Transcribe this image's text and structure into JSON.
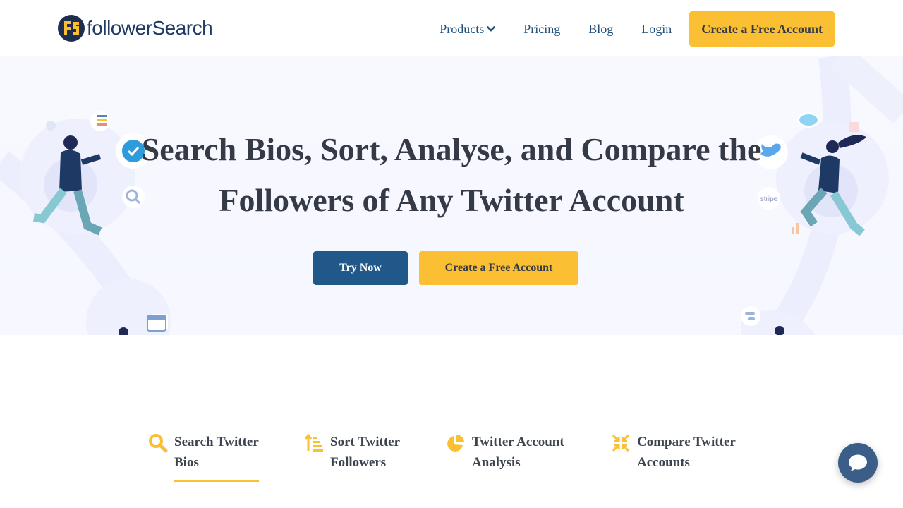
{
  "header": {
    "logo_text": "followerSearch",
    "nav": {
      "products": "Products",
      "pricing": "Pricing",
      "blog": "Blog",
      "login": "Login",
      "cta": "Create a Free Account"
    }
  },
  "hero": {
    "title_line1": "Search Bios, Sort, Analyse, and Compare the",
    "title_line2": "Followers of Any Twitter Account",
    "try_now": "Try Now",
    "create_account": "Create a Free Account",
    "stripe_label": "stripe"
  },
  "features": [
    {
      "label_line1": "Search Twitter",
      "label_line2": "Bios",
      "icon": "search-icon",
      "active": true
    },
    {
      "label_line1": "Sort Twitter",
      "label_line2": "Followers",
      "icon": "sort-icon",
      "active": false
    },
    {
      "label_line1": "Twitter Account",
      "label_line2": "Analysis",
      "icon": "pie-chart-icon",
      "active": false
    },
    {
      "label_line1": "Compare Twitter",
      "label_line2": "Accounts",
      "icon": "compress-icon",
      "active": false
    }
  ],
  "colors": {
    "accent_yellow": "#fbbf33",
    "primary_blue": "#20588a",
    "nav_blue": "#1f4e79",
    "text_dark": "#343a46"
  },
  "chat": {
    "icon": "chat-bubble-icon"
  }
}
